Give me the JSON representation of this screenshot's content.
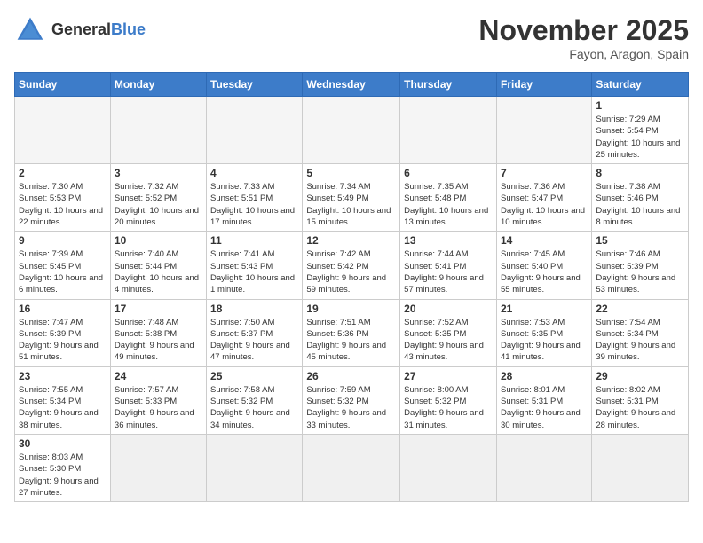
{
  "header": {
    "logo_general": "General",
    "logo_blue": "Blue",
    "month_title": "November 2025",
    "location": "Fayon, Aragon, Spain"
  },
  "days_of_week": [
    "Sunday",
    "Monday",
    "Tuesday",
    "Wednesday",
    "Thursday",
    "Friday",
    "Saturday"
  ],
  "weeks": [
    [
      {
        "day": "",
        "info": ""
      },
      {
        "day": "",
        "info": ""
      },
      {
        "day": "",
        "info": ""
      },
      {
        "day": "",
        "info": ""
      },
      {
        "day": "",
        "info": ""
      },
      {
        "day": "",
        "info": ""
      },
      {
        "day": "1",
        "info": "Sunrise: 7:29 AM\nSunset: 5:54 PM\nDaylight: 10 hours\nand 25 minutes."
      }
    ],
    [
      {
        "day": "2",
        "info": "Sunrise: 7:30 AM\nSunset: 5:53 PM\nDaylight: 10 hours\nand 22 minutes."
      },
      {
        "day": "3",
        "info": "Sunrise: 7:32 AM\nSunset: 5:52 PM\nDaylight: 10 hours\nand 20 minutes."
      },
      {
        "day": "4",
        "info": "Sunrise: 7:33 AM\nSunset: 5:51 PM\nDaylight: 10 hours\nand 17 minutes."
      },
      {
        "day": "5",
        "info": "Sunrise: 7:34 AM\nSunset: 5:49 PM\nDaylight: 10 hours\nand 15 minutes."
      },
      {
        "day": "6",
        "info": "Sunrise: 7:35 AM\nSunset: 5:48 PM\nDaylight: 10 hours\nand 13 minutes."
      },
      {
        "day": "7",
        "info": "Sunrise: 7:36 AM\nSunset: 5:47 PM\nDaylight: 10 hours\nand 10 minutes."
      },
      {
        "day": "8",
        "info": "Sunrise: 7:38 AM\nSunset: 5:46 PM\nDaylight: 10 hours\nand 8 minutes."
      }
    ],
    [
      {
        "day": "9",
        "info": "Sunrise: 7:39 AM\nSunset: 5:45 PM\nDaylight: 10 hours\nand 6 minutes."
      },
      {
        "day": "10",
        "info": "Sunrise: 7:40 AM\nSunset: 5:44 PM\nDaylight: 10 hours\nand 4 minutes."
      },
      {
        "day": "11",
        "info": "Sunrise: 7:41 AM\nSunset: 5:43 PM\nDaylight: 10 hours\nand 1 minute."
      },
      {
        "day": "12",
        "info": "Sunrise: 7:42 AM\nSunset: 5:42 PM\nDaylight: 9 hours\nand 59 minutes."
      },
      {
        "day": "13",
        "info": "Sunrise: 7:44 AM\nSunset: 5:41 PM\nDaylight: 9 hours\nand 57 minutes."
      },
      {
        "day": "14",
        "info": "Sunrise: 7:45 AM\nSunset: 5:40 PM\nDaylight: 9 hours\nand 55 minutes."
      },
      {
        "day": "15",
        "info": "Sunrise: 7:46 AM\nSunset: 5:39 PM\nDaylight: 9 hours\nand 53 minutes."
      }
    ],
    [
      {
        "day": "16",
        "info": "Sunrise: 7:47 AM\nSunset: 5:39 PM\nDaylight: 9 hours\nand 51 minutes."
      },
      {
        "day": "17",
        "info": "Sunrise: 7:48 AM\nSunset: 5:38 PM\nDaylight: 9 hours\nand 49 minutes."
      },
      {
        "day": "18",
        "info": "Sunrise: 7:50 AM\nSunset: 5:37 PM\nDaylight: 9 hours\nand 47 minutes."
      },
      {
        "day": "19",
        "info": "Sunrise: 7:51 AM\nSunset: 5:36 PM\nDaylight: 9 hours\nand 45 minutes."
      },
      {
        "day": "20",
        "info": "Sunrise: 7:52 AM\nSunset: 5:35 PM\nDaylight: 9 hours\nand 43 minutes."
      },
      {
        "day": "21",
        "info": "Sunrise: 7:53 AM\nSunset: 5:35 PM\nDaylight: 9 hours\nand 41 minutes."
      },
      {
        "day": "22",
        "info": "Sunrise: 7:54 AM\nSunset: 5:34 PM\nDaylight: 9 hours\nand 39 minutes."
      }
    ],
    [
      {
        "day": "23",
        "info": "Sunrise: 7:55 AM\nSunset: 5:34 PM\nDaylight: 9 hours\nand 38 minutes."
      },
      {
        "day": "24",
        "info": "Sunrise: 7:57 AM\nSunset: 5:33 PM\nDaylight: 9 hours\nand 36 minutes."
      },
      {
        "day": "25",
        "info": "Sunrise: 7:58 AM\nSunset: 5:32 PM\nDaylight: 9 hours\nand 34 minutes."
      },
      {
        "day": "26",
        "info": "Sunrise: 7:59 AM\nSunset: 5:32 PM\nDaylight: 9 hours\nand 33 minutes."
      },
      {
        "day": "27",
        "info": "Sunrise: 8:00 AM\nSunset: 5:32 PM\nDaylight: 9 hours\nand 31 minutes."
      },
      {
        "day": "28",
        "info": "Sunrise: 8:01 AM\nSunset: 5:31 PM\nDaylight: 9 hours\nand 30 minutes."
      },
      {
        "day": "29",
        "info": "Sunrise: 8:02 AM\nSunset: 5:31 PM\nDaylight: 9 hours\nand 28 minutes."
      }
    ],
    [
      {
        "day": "30",
        "info": "Sunrise: 8:03 AM\nSunset: 5:30 PM\nDaylight: 9 hours\nand 27 minutes."
      },
      {
        "day": "",
        "info": ""
      },
      {
        "day": "",
        "info": ""
      },
      {
        "day": "",
        "info": ""
      },
      {
        "day": "",
        "info": ""
      },
      {
        "day": "",
        "info": ""
      },
      {
        "day": "",
        "info": ""
      }
    ]
  ]
}
